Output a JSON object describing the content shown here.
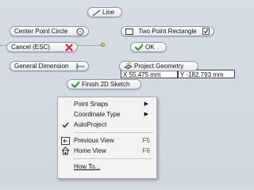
{
  "marking_menu": {
    "line": "Line",
    "center_point_circle": "Center Point Circle",
    "two_point_rectangle": "Two Point Rectangle",
    "cancel": "Cancel (ESC)",
    "ok": "OK",
    "general_dimension": "General Dimension",
    "project_geometry": "Project Geometry",
    "finish_sketch": "Finish 2D Sketch"
  },
  "dimension_input": {
    "x_label": "X",
    "x_value": "55.475 mm",
    "y_label": "Y",
    "y_value": "-182.793 mm"
  },
  "context_menu": {
    "point_snaps": "Point Snaps",
    "coordinate_type": "Coordinate Type",
    "autoproject": "AutoProject",
    "previous_view": "Previous View",
    "previous_view_shortcut": "F5",
    "home_view": "Home View",
    "home_view_shortcut": "F6",
    "how_to": "How To..."
  },
  "colors": {
    "cancel_x": "#d9232e",
    "ok_check": "#2f9e3a",
    "dotted_line": "#6b7fd0"
  }
}
